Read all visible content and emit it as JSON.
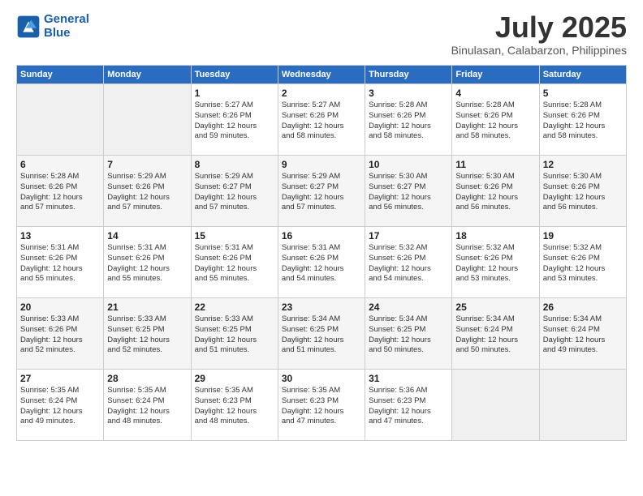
{
  "header": {
    "logo_line1": "General",
    "logo_line2": "Blue",
    "month_year": "July 2025",
    "location": "Binulasan, Calabarzon, Philippines"
  },
  "days_of_week": [
    "Sunday",
    "Monday",
    "Tuesday",
    "Wednesday",
    "Thursday",
    "Friday",
    "Saturday"
  ],
  "weeks": [
    [
      {
        "day": "",
        "detail": ""
      },
      {
        "day": "",
        "detail": ""
      },
      {
        "day": "1",
        "detail": "Sunrise: 5:27 AM\nSunset: 6:26 PM\nDaylight: 12 hours\nand 59 minutes."
      },
      {
        "day": "2",
        "detail": "Sunrise: 5:27 AM\nSunset: 6:26 PM\nDaylight: 12 hours\nand 58 minutes."
      },
      {
        "day": "3",
        "detail": "Sunrise: 5:28 AM\nSunset: 6:26 PM\nDaylight: 12 hours\nand 58 minutes."
      },
      {
        "day": "4",
        "detail": "Sunrise: 5:28 AM\nSunset: 6:26 PM\nDaylight: 12 hours\nand 58 minutes."
      },
      {
        "day": "5",
        "detail": "Sunrise: 5:28 AM\nSunset: 6:26 PM\nDaylight: 12 hours\nand 58 minutes."
      }
    ],
    [
      {
        "day": "6",
        "detail": "Sunrise: 5:28 AM\nSunset: 6:26 PM\nDaylight: 12 hours\nand 57 minutes."
      },
      {
        "day": "7",
        "detail": "Sunrise: 5:29 AM\nSunset: 6:26 PM\nDaylight: 12 hours\nand 57 minutes."
      },
      {
        "day": "8",
        "detail": "Sunrise: 5:29 AM\nSunset: 6:27 PM\nDaylight: 12 hours\nand 57 minutes."
      },
      {
        "day": "9",
        "detail": "Sunrise: 5:29 AM\nSunset: 6:27 PM\nDaylight: 12 hours\nand 57 minutes."
      },
      {
        "day": "10",
        "detail": "Sunrise: 5:30 AM\nSunset: 6:27 PM\nDaylight: 12 hours\nand 56 minutes."
      },
      {
        "day": "11",
        "detail": "Sunrise: 5:30 AM\nSunset: 6:26 PM\nDaylight: 12 hours\nand 56 minutes."
      },
      {
        "day": "12",
        "detail": "Sunrise: 5:30 AM\nSunset: 6:26 PM\nDaylight: 12 hours\nand 56 minutes."
      }
    ],
    [
      {
        "day": "13",
        "detail": "Sunrise: 5:31 AM\nSunset: 6:26 PM\nDaylight: 12 hours\nand 55 minutes."
      },
      {
        "day": "14",
        "detail": "Sunrise: 5:31 AM\nSunset: 6:26 PM\nDaylight: 12 hours\nand 55 minutes."
      },
      {
        "day": "15",
        "detail": "Sunrise: 5:31 AM\nSunset: 6:26 PM\nDaylight: 12 hours\nand 55 minutes."
      },
      {
        "day": "16",
        "detail": "Sunrise: 5:31 AM\nSunset: 6:26 PM\nDaylight: 12 hours\nand 54 minutes."
      },
      {
        "day": "17",
        "detail": "Sunrise: 5:32 AM\nSunset: 6:26 PM\nDaylight: 12 hours\nand 54 minutes."
      },
      {
        "day": "18",
        "detail": "Sunrise: 5:32 AM\nSunset: 6:26 PM\nDaylight: 12 hours\nand 53 minutes."
      },
      {
        "day": "19",
        "detail": "Sunrise: 5:32 AM\nSunset: 6:26 PM\nDaylight: 12 hours\nand 53 minutes."
      }
    ],
    [
      {
        "day": "20",
        "detail": "Sunrise: 5:33 AM\nSunset: 6:26 PM\nDaylight: 12 hours\nand 52 minutes."
      },
      {
        "day": "21",
        "detail": "Sunrise: 5:33 AM\nSunset: 6:25 PM\nDaylight: 12 hours\nand 52 minutes."
      },
      {
        "day": "22",
        "detail": "Sunrise: 5:33 AM\nSunset: 6:25 PM\nDaylight: 12 hours\nand 51 minutes."
      },
      {
        "day": "23",
        "detail": "Sunrise: 5:34 AM\nSunset: 6:25 PM\nDaylight: 12 hours\nand 51 minutes."
      },
      {
        "day": "24",
        "detail": "Sunrise: 5:34 AM\nSunset: 6:25 PM\nDaylight: 12 hours\nand 50 minutes."
      },
      {
        "day": "25",
        "detail": "Sunrise: 5:34 AM\nSunset: 6:24 PM\nDaylight: 12 hours\nand 50 minutes."
      },
      {
        "day": "26",
        "detail": "Sunrise: 5:34 AM\nSunset: 6:24 PM\nDaylight: 12 hours\nand 49 minutes."
      }
    ],
    [
      {
        "day": "27",
        "detail": "Sunrise: 5:35 AM\nSunset: 6:24 PM\nDaylight: 12 hours\nand 49 minutes."
      },
      {
        "day": "28",
        "detail": "Sunrise: 5:35 AM\nSunset: 6:24 PM\nDaylight: 12 hours\nand 48 minutes."
      },
      {
        "day": "29",
        "detail": "Sunrise: 5:35 AM\nSunset: 6:23 PM\nDaylight: 12 hours\nand 48 minutes."
      },
      {
        "day": "30",
        "detail": "Sunrise: 5:35 AM\nSunset: 6:23 PM\nDaylight: 12 hours\nand 47 minutes."
      },
      {
        "day": "31",
        "detail": "Sunrise: 5:36 AM\nSunset: 6:23 PM\nDaylight: 12 hours\nand 47 minutes."
      },
      {
        "day": "",
        "detail": ""
      },
      {
        "day": "",
        "detail": ""
      }
    ]
  ]
}
